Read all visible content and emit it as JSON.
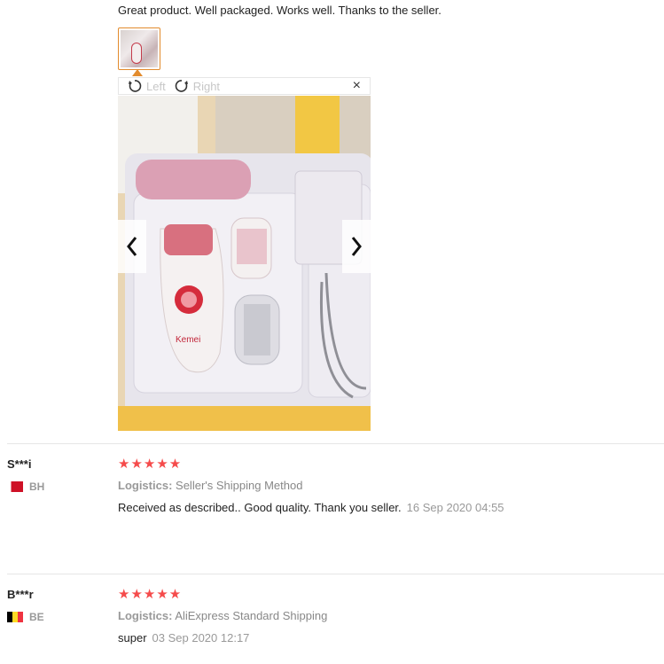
{
  "review1": {
    "text": "Great product. Well packaged. Works well. Thanks to the seller."
  },
  "viewer": {
    "rotate_left_label": "Left",
    "rotate_right_label": "Right",
    "close_label": "×"
  },
  "review2": {
    "name": "S***i",
    "country": "BH",
    "stars": "★★★★★",
    "logistics_label": "Logistics:",
    "logistics_value": "Seller's Shipping Method",
    "text": "Received as described.. Good quality. Thank you seller.",
    "date": "16 Sep 2020 04:55"
  },
  "review3": {
    "name": "B***r",
    "country": "BE",
    "stars": "★★★★★",
    "logistics_label": "Logistics:",
    "logistics_value": "AliExpress Standard Shipping",
    "text": "super",
    "date": "03 Sep 2020 12:17"
  },
  "colors": {
    "accent": "#e28b2d",
    "stars": "#f54b4b",
    "flag_bh": "#ce1126",
    "flag_be": [
      "#000000",
      "#fdda24",
      "#ef3340"
    ]
  },
  "photo": {
    "brand_text": "Kemei"
  }
}
